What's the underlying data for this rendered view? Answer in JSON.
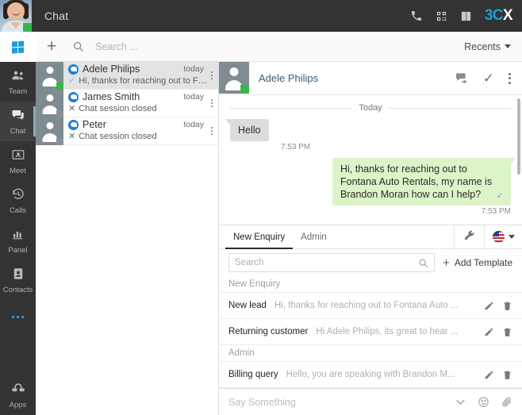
{
  "topbar": {
    "title": "Chat",
    "avatar_name": "user-photo",
    "status_color": "#3ab54a",
    "icons": [
      "phone-icon",
      "qr-code-icon",
      "address-book-icon"
    ],
    "logo_part1": "3C",
    "logo_part2": "X"
  },
  "rail": {
    "os_logo": "windows-logo",
    "items": [
      {
        "label": "Team",
        "icon": "team-icon",
        "active": false
      },
      {
        "label": "Chat",
        "icon": "chat-icon",
        "active": true
      },
      {
        "label": "Meet",
        "icon": "meet-icon",
        "active": false
      },
      {
        "label": "Calls",
        "icon": "calls-icon",
        "active": false
      },
      {
        "label": "Panel",
        "icon": "panel-icon",
        "active": false
      },
      {
        "label": "Contacts",
        "icon": "contacts-icon",
        "active": false
      }
    ],
    "more_label": "more-icon",
    "apps_label": "Apps"
  },
  "list_toolbar": {
    "add_label": "+",
    "search_placeholder": "Search ...",
    "search_value": "",
    "filter_label": "Recents"
  },
  "chat_list": [
    {
      "name": "Adele Philips",
      "time": "today",
      "preview": "Hi, thanks for reaching out to Fo...",
      "marker": "tick",
      "status": "online",
      "selected": true
    },
    {
      "name": "James Smith",
      "time": "today",
      "preview": "Chat session closed",
      "marker": "close",
      "status": "offline",
      "selected": false
    },
    {
      "name": "Peter",
      "time": "today",
      "preview": "Chat session closed",
      "marker": "close",
      "status": "offline",
      "selected": false
    }
  ],
  "conversation": {
    "contact_name": "Adele Philips",
    "status": "online",
    "day_separator": "Today",
    "messages": [
      {
        "direction": "in",
        "text": "Hello",
        "time": "7:53 PM"
      },
      {
        "direction": "out",
        "text": "Hi, thanks for reaching out to Fontana Auto Rentals, my name is Brandon Moran how can I help?",
        "time": "7:53 PM"
      }
    ]
  },
  "templates": {
    "tabs": [
      {
        "label": "New Enquiry",
        "active": true
      },
      {
        "label": "Admin",
        "active": false
      }
    ],
    "settings_icon": "wrench-icon",
    "language_icon": "us-flag-icon",
    "search_placeholder": "Search",
    "search_value": "",
    "add_label": "Add Template",
    "groups": [
      {
        "title": "New Enquiry",
        "rows": [
          {
            "name": "New lead",
            "preview": "Hi, thanks for reaching out to Fontana Auto ..."
          },
          {
            "name": "Returning customer",
            "preview": "Hi Adele Philips, its great to hear ..."
          }
        ]
      },
      {
        "title": "Admin",
        "rows": [
          {
            "name": "Billing query",
            "preview": "Hello, you are speaking with Brandon M..."
          }
        ]
      }
    ]
  },
  "composer": {
    "placeholder": "Say Something",
    "value": "",
    "icons": [
      "chevron-down-icon",
      "emoji-icon",
      "attachment-icon"
    ]
  }
}
